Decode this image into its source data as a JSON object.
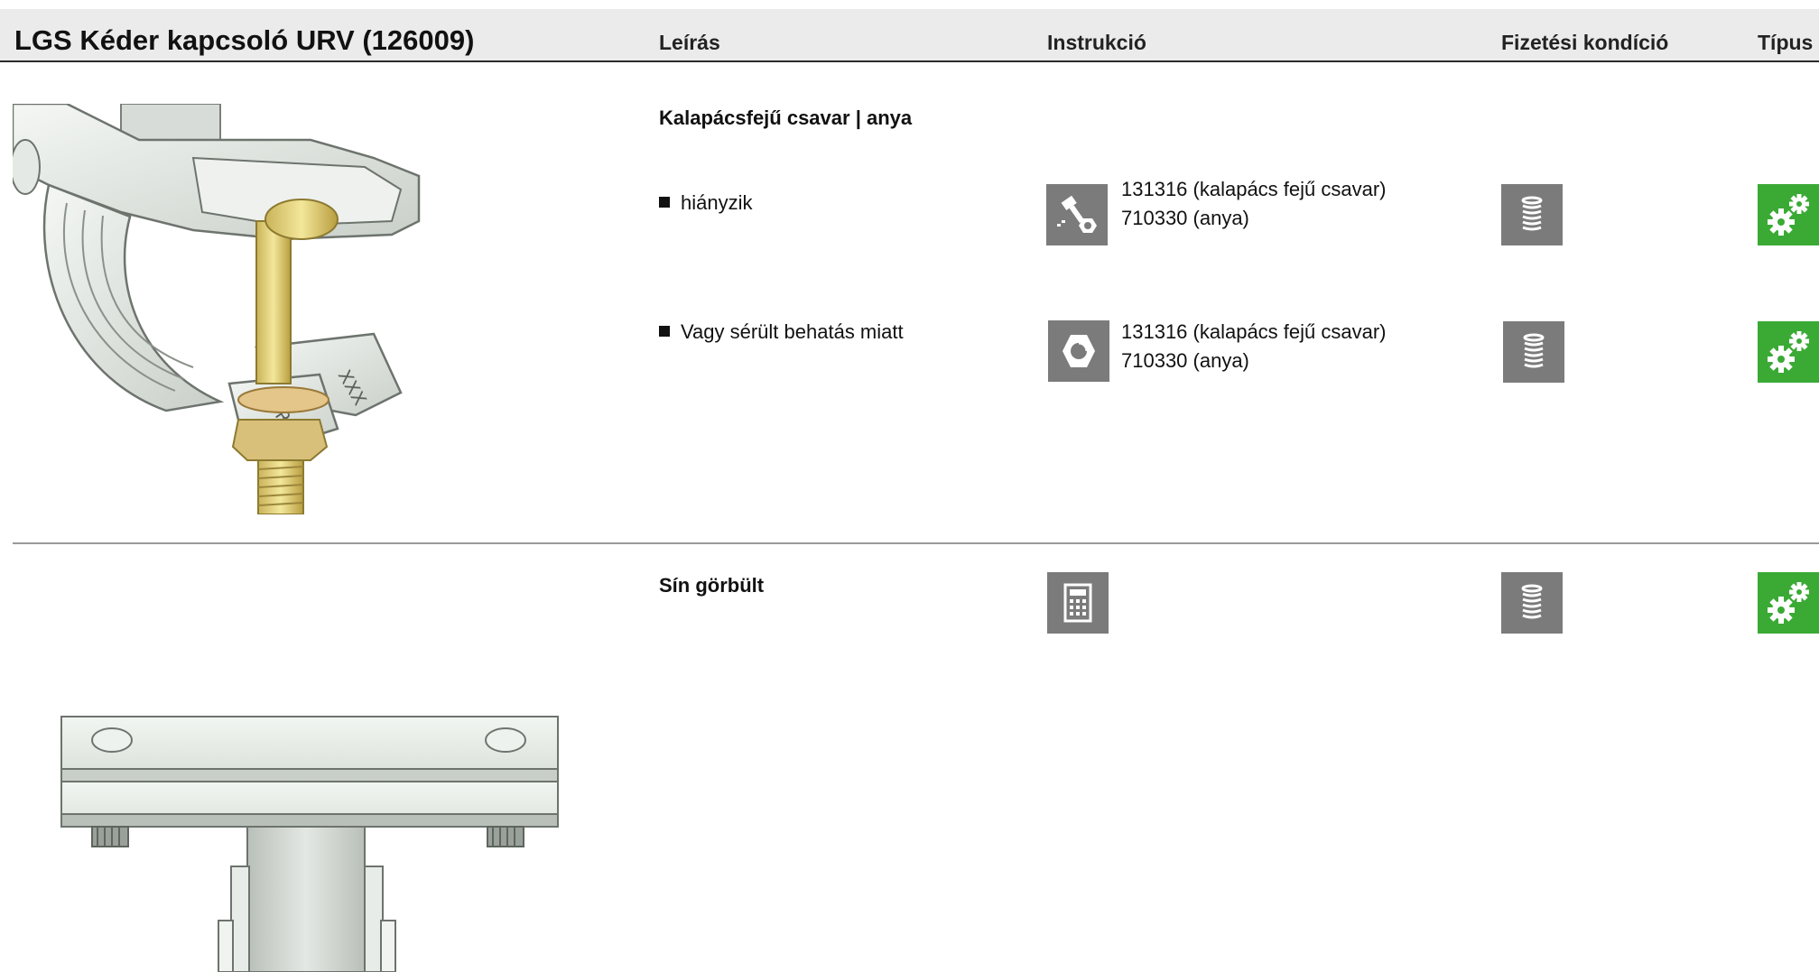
{
  "header": {
    "title": "LGS Kéder kapcsoló URV (126009)",
    "columns": [
      "Leírás",
      "Instrukció",
      "Fizetési kondíció",
      "Típus"
    ]
  },
  "sections": [
    {
      "title": "Kalapácsfejű csavar | anya",
      "items": [
        {
          "description": "hiányzik",
          "instruction_icon": "bolt-nut-icon",
          "instruction_lines": [
            "131316 (kalapács fejű csavar)",
            "710330 (anya)"
          ],
          "payment_icon": "coin-stack-icon",
          "type_icon": "gears-icon"
        },
        {
          "description": "Vagy sérült behatás miatt",
          "instruction_icon": "nut-icon",
          "instruction_lines": [
            "131316 (kalapács fejű csavar)",
            "710330 (anya)"
          ],
          "payment_icon": "coin-stack-icon",
          "type_icon": "gears-icon"
        }
      ]
    },
    {
      "title": "Sín görbült",
      "instruction_icon": "calculator-icon",
      "payment_icon": "coin-stack-icon",
      "type_icon": "gears-icon"
    }
  ],
  "colors": {
    "icon_gray": "#7b7b7b",
    "type_green": "#3aaa35",
    "header_bg": "#ebebeb"
  }
}
